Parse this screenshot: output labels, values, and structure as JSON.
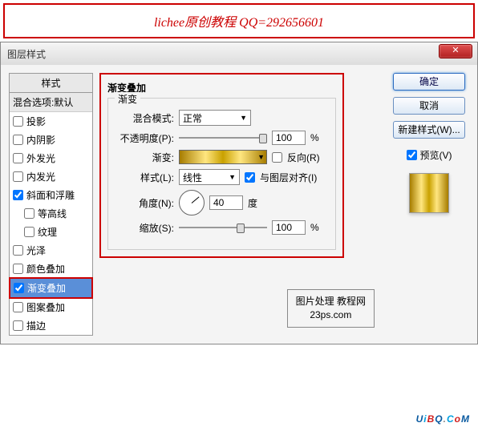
{
  "banner": "lichee原创教程 QQ=292656601",
  "dialog": {
    "title": "图层样式"
  },
  "sidebar": {
    "header": "样式",
    "blend_default": "混合选项:默认",
    "items": [
      {
        "label": "投影",
        "checked": false
      },
      {
        "label": "内阴影",
        "checked": false
      },
      {
        "label": "外发光",
        "checked": false
      },
      {
        "label": "内发光",
        "checked": false
      },
      {
        "label": "斜面和浮雕",
        "checked": true
      },
      {
        "label": "等高线",
        "checked": false,
        "indent": true
      },
      {
        "label": "纹理",
        "checked": false,
        "indent": true
      },
      {
        "label": "光泽",
        "checked": false
      },
      {
        "label": "颜色叠加",
        "checked": false
      },
      {
        "label": "渐变叠加",
        "checked": true,
        "selected": true
      },
      {
        "label": "图案叠加",
        "checked": false
      },
      {
        "label": "描边",
        "checked": false
      }
    ]
  },
  "content": {
    "group_title": "渐变叠加",
    "sub_legend": "渐变",
    "blend_mode_label": "混合模式:",
    "blend_mode_value": "正常",
    "opacity_label": "不透明度(P):",
    "opacity_value": "100",
    "opacity_unit": "%",
    "gradient_label": "渐变:",
    "reverse_label": "反向(R)",
    "style_label": "样式(L):",
    "style_value": "线性",
    "align_label": "与图层对齐(I)",
    "angle_label": "角度(N):",
    "angle_value": "40",
    "angle_unit": "度",
    "scale_label": "缩放(S):",
    "scale_value": "100",
    "scale_unit": "%"
  },
  "buttons": {
    "ok": "确定",
    "cancel": "取消",
    "new_style": "新建样式(W)...",
    "preview": "预览(V)"
  },
  "watermark": {
    "line1": "图片处理 教程网",
    "line2": "23ps.com"
  },
  "close_icon": "✕"
}
